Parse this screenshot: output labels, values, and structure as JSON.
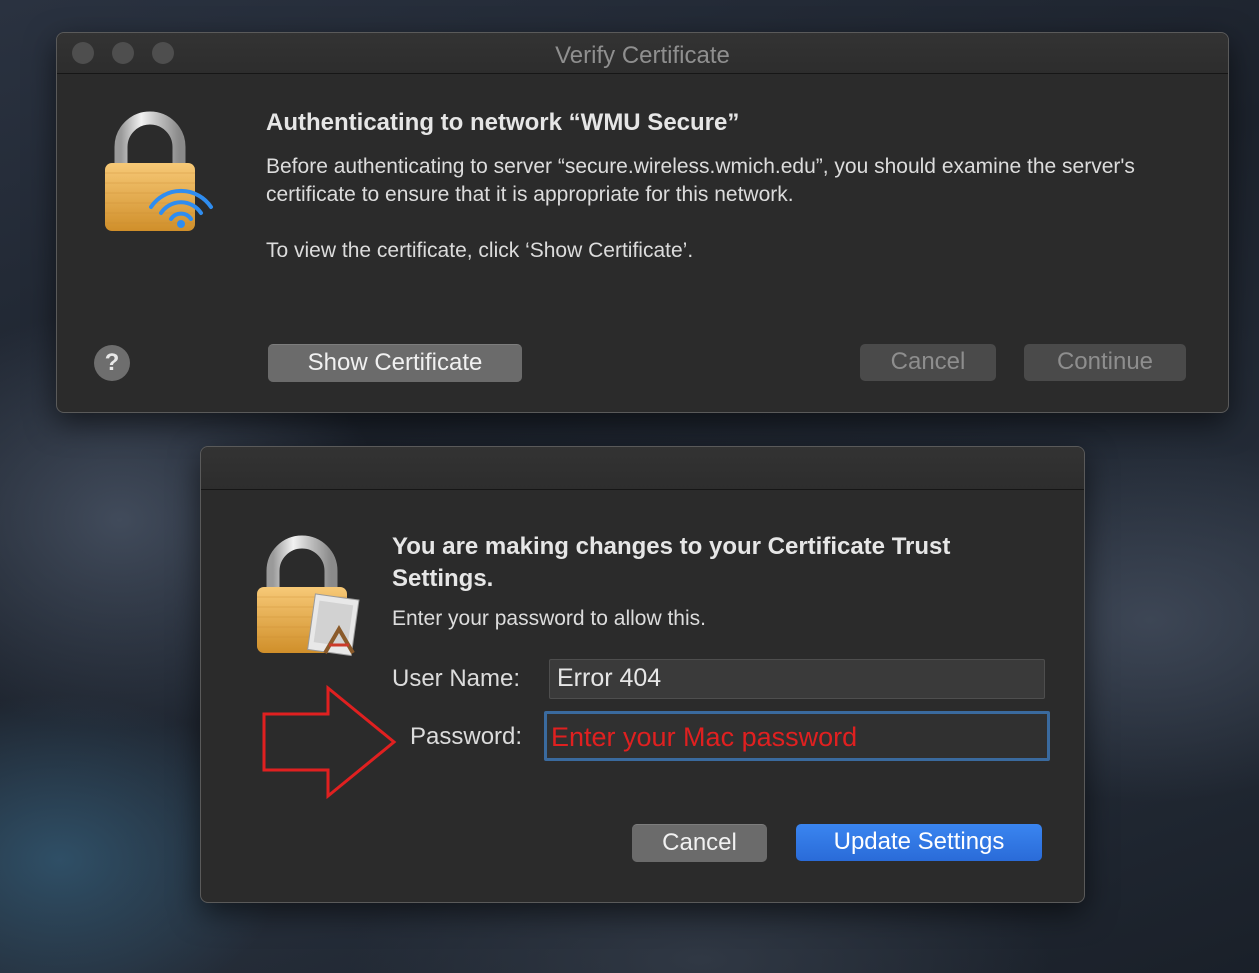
{
  "verify_window": {
    "title": "Verify Certificate",
    "heading": "Authenticating to network “WMU Secure”",
    "message": "Before authenticating to server “secure.wireless.wmich.edu”, you should examine the server's certificate to ensure that it is appropriate for this network.",
    "hint": "To view the certificate, click ‘Show Certificate’.",
    "help_label": "?",
    "show_certificate_label": "Show Certificate",
    "cancel_label": "Cancel",
    "continue_label": "Continue",
    "icon": "lock-wifi-icon"
  },
  "auth_window": {
    "heading": "You are making changes to your Certificate Trust Settings.",
    "subtext": "Enter your password to allow this.",
    "username_label": "User Name:",
    "username_value": "Error 404",
    "password_label": "Password:",
    "password_annotation": "Enter your Mac password",
    "cancel_label": "Cancel",
    "update_label": "Update Settings",
    "icon": "lock-certificate-icon"
  },
  "annotation": {
    "arrow": "red-arrow-icon",
    "color": "#e02020"
  },
  "colors": {
    "accent": "#2a6bd8",
    "window_bg": "#2b2b2b",
    "annotation_red": "#e02020"
  }
}
